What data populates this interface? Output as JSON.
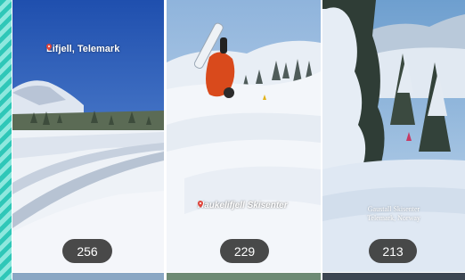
{
  "tiles": [
    {
      "location": "Lifjell, Telemark",
      "views": "256"
    },
    {
      "location": "Haukelifjell Skisenter",
      "views": "229"
    },
    {
      "location_line1": "Gaustall Skisenter",
      "location_line2": "Telemark, Norway",
      "views": "213"
    }
  ],
  "icons": {
    "location_pin": "map-pin-icon"
  },
  "colors": {
    "accent_stripe": "#2fc7b8",
    "pin": "#e0463c",
    "pill": "#3a3a3a"
  }
}
